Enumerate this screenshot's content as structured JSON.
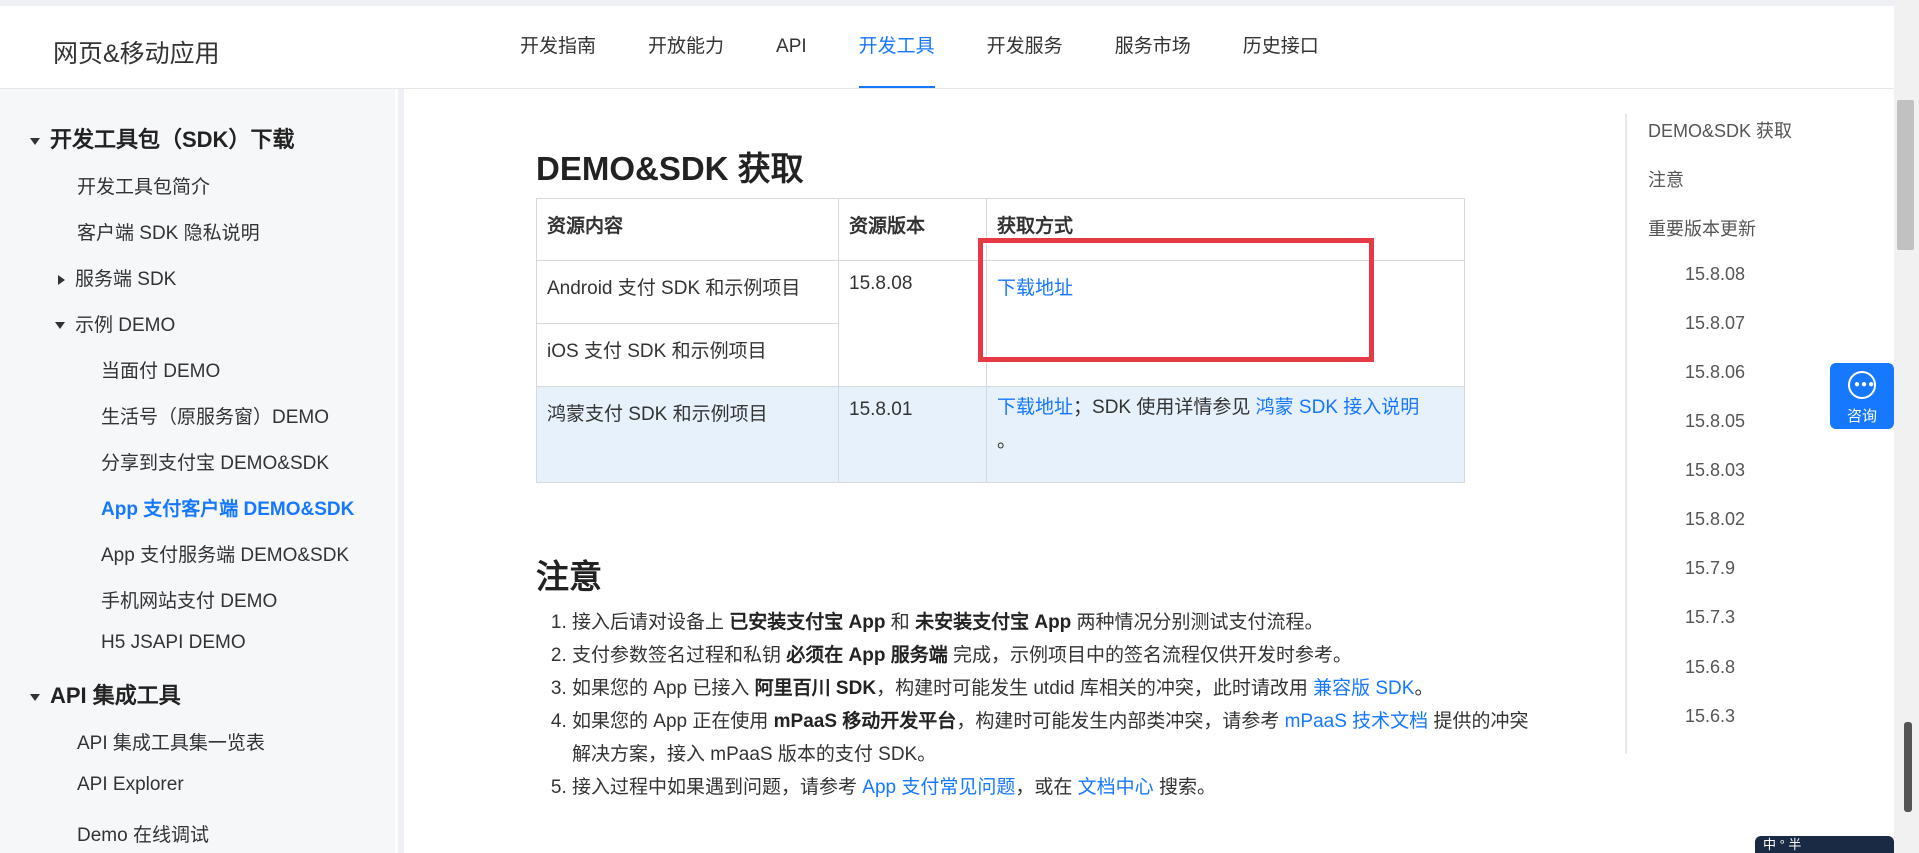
{
  "header": {
    "brand": "网页&移动应用",
    "nav": [
      "开发指南",
      "开放能力",
      "API",
      "开发工具",
      "开发服务",
      "服务市场",
      "历史接口"
    ],
    "active_nav_index": 3
  },
  "sidebar": {
    "group1": "开发工具包（SDK）下载",
    "items1": {
      "sdk_intro": "开发工具包简介",
      "privacy": "客户端 SDK 隐私说明",
      "server_sdk": "服务端 SDK",
      "demo": "示例 DEMO"
    },
    "demo_children": {
      "f2f": "当面付 DEMO",
      "life": "生活号（原服务窗）DEMO",
      "share": "分享到支付宝 DEMO&SDK",
      "app_client": "App 支付客户端 DEMO&SDK",
      "app_server": "App 支付服务端 DEMO&SDK",
      "wap": "手机网站支付 DEMO",
      "h5": "H5 JSAPI DEMO"
    },
    "group2": "API 集成工具",
    "items2": {
      "overview": "API 集成工具集一览表",
      "explorer": "API Explorer",
      "demo_debug": "Demo 在线调试"
    }
  },
  "main": {
    "section1_title": "DEMO&SDK 获取",
    "table": {
      "headers": [
        "资源内容",
        "资源版本",
        "获取方式"
      ],
      "row1": {
        "content": "Android 支付 SDK 和示例项目",
        "version": "15.8.08",
        "link": "下载地址"
      },
      "row2": {
        "content": "iOS 支付 SDK 和示例项目"
      },
      "row3": {
        "content": "鸿蒙支付 SDK 和示例项目",
        "version": "15.8.01",
        "link": "下载地址",
        "text1": "；SDK 使用详情参见 ",
        "link2": "鸿蒙 SDK 接入说明",
        "text2": "。"
      }
    },
    "section2_title": "注意",
    "notes": {
      "n1": {
        "a": "接入后请对设备上 ",
        "b1": "已安装支付宝 App",
        "c": " 和 ",
        "b2": "未安装支付宝 App",
        "d": " 两种情况分别测试支付流程。"
      },
      "n2": {
        "a": "支付参数签名过程和私钥 ",
        "b1": "必须在 App 服务端",
        "c": " 完成，示例项目中的签名流程仅供开发时参考。"
      },
      "n3": {
        "a": "如果您的 App 已接入 ",
        "b1": "阿里百川 SDK",
        "c": "，构建时可能发生 utdid 库相关的冲突，此时请改用 ",
        "link": "兼容版 SDK",
        "d": "。"
      },
      "n4": {
        "a": "如果您的 App 正在使用 ",
        "b1": "mPaaS 移动开发平台",
        "c": "，构建时可能发生内部类冲突，请参考 ",
        "link": "mPaaS 技术文档",
        "d": " 提供的冲突解决方案，接入 mPaaS 版本的支付 SDK。"
      },
      "n5": {
        "a": "接入过程中如果遇到问题，请参考 ",
        "link1": "App 支付常见问题",
        "c": "，或在 ",
        "link2": "文档中心",
        "d": " 搜索。"
      }
    }
  },
  "toc": {
    "items": [
      "DEMO&SDK 获取",
      "注意",
      "重要版本更新"
    ],
    "versions": [
      "15.8.08",
      "15.8.07",
      "15.8.06",
      "15.8.05",
      "15.8.03",
      "15.8.02",
      "15.7.9",
      "15.7.3",
      "15.6.8",
      "15.6.3"
    ]
  },
  "consult_label": "咨询",
  "ime_text": "中 ° 半",
  "colors": {
    "accent": "#1677ff",
    "highlight_box": "#e63946",
    "row_highlight": "#e6f1fc"
  }
}
